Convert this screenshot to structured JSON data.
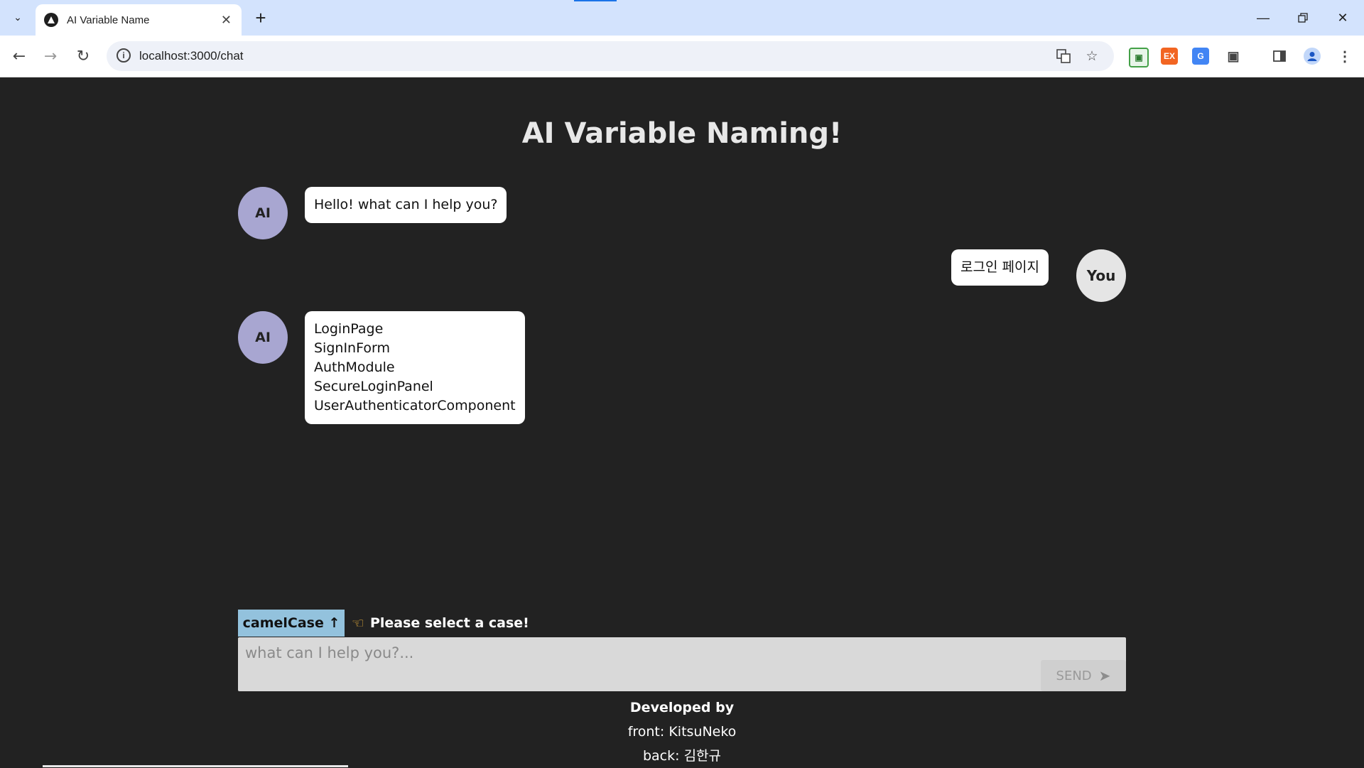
{
  "browser": {
    "tab_title": "AI Variable Name",
    "url": "localhost:3000/chat"
  },
  "page": {
    "title": "AI Variable Naming!",
    "messages": [
      {
        "sender": "AI",
        "lines": [
          "Hello! what can I help you?"
        ]
      },
      {
        "sender": "You",
        "lines": [
          "로그인 페이지"
        ]
      },
      {
        "sender": "AI",
        "lines": [
          "LoginPage",
          "SignInForm",
          "AuthModule",
          "SecureLoginPanel",
          "UserAuthenticatorComponent"
        ]
      }
    ],
    "case_button": "camelCase ↑",
    "case_hint": "Please select a case!",
    "input_placeholder": "what can I help you?...",
    "send_label": "SEND",
    "footer": {
      "developed_by": "Developed by",
      "front": "front: KitsuNeko",
      "back": "back: 김한규"
    }
  },
  "colors": {
    "background": "#222222",
    "ai_avatar": "#a8a6d1",
    "user_avatar": "#e5e5e5",
    "case_button": "#93c2dd",
    "input_bg": "#d9d9d9"
  }
}
